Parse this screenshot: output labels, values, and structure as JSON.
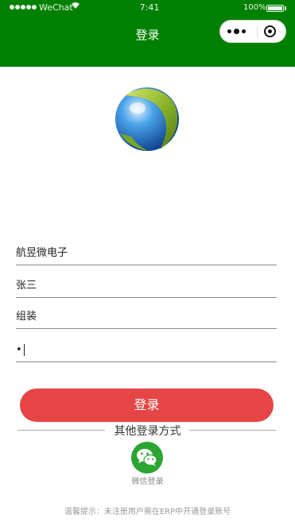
{
  "status_bar": {
    "carrier": "WeChat",
    "time": "7:41",
    "battery": "100%"
  },
  "nav": {
    "title": "登录"
  },
  "capsule": {
    "more_icon": "more-dots-icon",
    "close_icon": "target-close-icon"
  },
  "logo": {
    "icon": "globe-logo-icon"
  },
  "form": {
    "company_value": "航昱微电子",
    "username_value": "张三",
    "department_value": "组装",
    "password_masked": "•"
  },
  "actions": {
    "login_label": "登录"
  },
  "other_login": {
    "heading": "其他登录方式",
    "wechat_label": "微信登录",
    "wechat_icon": "wechat-icon"
  },
  "footer": {
    "tip": "温馨提示：未注册用户需在ERP中开通登录账号"
  },
  "colors": {
    "header_green": "#008000",
    "login_red": "#e64545",
    "wechat_green": "#2aa530"
  }
}
